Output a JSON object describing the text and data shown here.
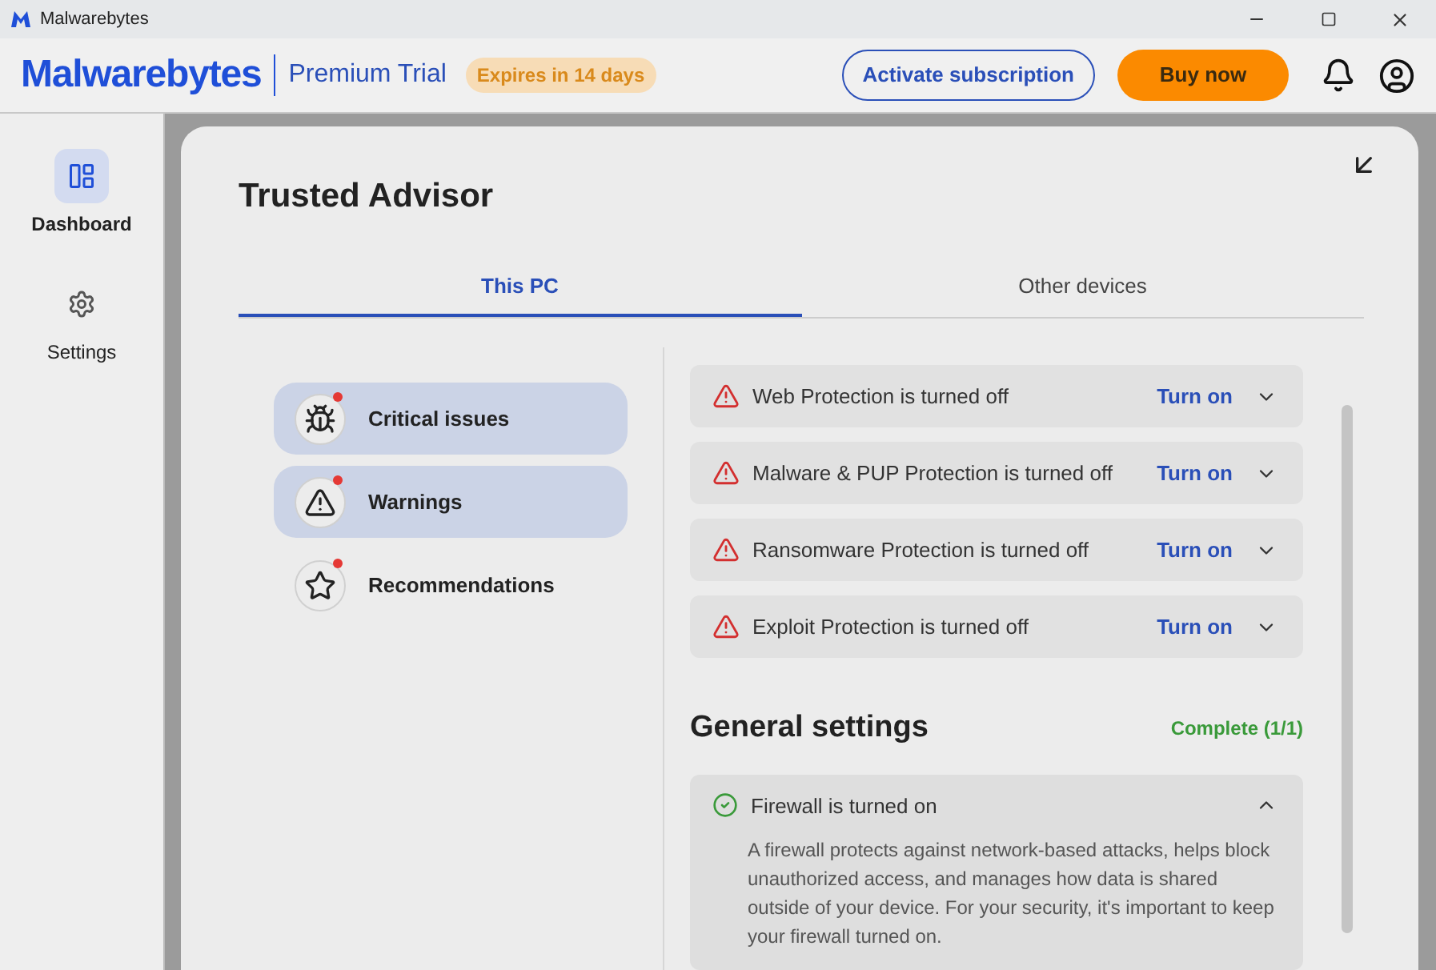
{
  "window": {
    "title": "Malwarebytes"
  },
  "header": {
    "logo": "Malwarebytes",
    "plan": "Premium Trial",
    "badge": "Expires in 14 days",
    "buttons": [
      {
        "label": "Activate subscription",
        "kind": "outline"
      },
      {
        "label": "Buy now",
        "kind": "primary"
      }
    ]
  },
  "sidebar": {
    "items": [
      {
        "label": "Dashboard",
        "kind": "dashboard",
        "selected": true
      },
      {
        "label": "Settings",
        "kind": "settings",
        "selected": false
      }
    ]
  },
  "panel": {
    "title": "Trusted Advisor",
    "tabs": [
      {
        "label": "This PC",
        "selected": true
      },
      {
        "label": "Other devices",
        "selected": false
      }
    ],
    "categories": [
      {
        "label": "Critical issues",
        "kind": "bug",
        "highlighted": true,
        "alert": true
      },
      {
        "label": "Warnings",
        "kind": "warning",
        "highlighted": true,
        "alert": true
      },
      {
        "label": "Recommendations",
        "kind": "star",
        "highlighted": false,
        "alert": true
      }
    ],
    "issues": [
      {
        "label": "Web Protection is turned off",
        "kind": "warning",
        "action": "Turn on",
        "expanded": false
      },
      {
        "label": "Malware & PUP Protection is turned off",
        "kind": "warning",
        "action": "Turn on",
        "expanded": false
      },
      {
        "label": "Ransomware Protection is turned off",
        "kind": "warning",
        "action": "Turn on",
        "expanded": false
      },
      {
        "label": "Exploit Protection is turned off",
        "kind": "warning",
        "action": "Turn on",
        "expanded": false
      }
    ],
    "section": {
      "title": "General settings",
      "status": "Complete (1/1)"
    },
    "settings": [
      {
        "label": "Firewall is turned on",
        "kind": "ok",
        "expanded": true,
        "description": "A firewall protects against network-based attacks, helps block unauthorized access, and manages how data is shared outside of your device. For your security, it's important to keep your firewall turned on."
      }
    ]
  }
}
